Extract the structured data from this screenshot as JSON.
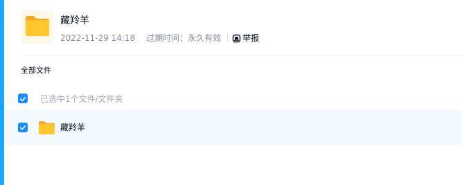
{
  "share": {
    "title": "藏羚羊",
    "date": "2022-11-29 14:18",
    "expire_label": "过期时间：永久有效",
    "report_label": "举报"
  },
  "breadcrumb": "全部文件",
  "selection": {
    "text": "已选中1个文件/文件夹",
    "checked": true
  },
  "files": [
    {
      "name": "藏羚羊",
      "type": "folder",
      "checked": true
    }
  ],
  "colors": {
    "accent": "#1aa5ff",
    "checkbox": "#1a8cff",
    "folder": "#ffc62e",
    "row_highlight": "#f4f9ff"
  },
  "icons": {
    "folder": "folder-icon",
    "report": "report-icon",
    "check": "check-icon"
  }
}
